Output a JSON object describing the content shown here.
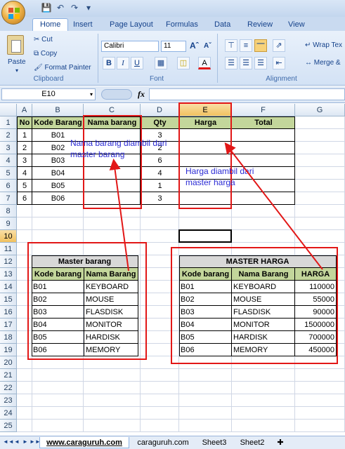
{
  "ribbon": {
    "tabs": [
      "Home",
      "Insert",
      "Page Layout",
      "Formulas",
      "Data",
      "Review",
      "View"
    ],
    "active_tab": "Home",
    "clipboard": {
      "paste": "Paste",
      "cut": "Cut",
      "copy": "Copy",
      "format_painter": "Format Painter",
      "label": "Clipboard"
    },
    "font": {
      "name": "Calibri",
      "size": "11",
      "label": "Font"
    },
    "alignment": {
      "wrap": "Wrap Tex",
      "merge": "Merge &",
      "label": "Alignment"
    }
  },
  "formula_bar": {
    "name_box": "E10",
    "fx": "fx",
    "value": ""
  },
  "grid": {
    "columns": [
      "A",
      "B",
      "C",
      "D",
      "E",
      "F",
      "G"
    ],
    "selected_column": "E",
    "rows": [
      "1",
      "2",
      "3",
      "4",
      "5",
      "6",
      "7",
      "8",
      "9",
      "10",
      "11",
      "12",
      "13",
      "14",
      "15",
      "16",
      "17",
      "18",
      "19",
      "20",
      "21",
      "22",
      "23",
      "24",
      "25"
    ],
    "selected_row": "10",
    "active_cell": "E10"
  },
  "main_table": {
    "headers": [
      "No",
      "Kode Barang",
      "Nama barang",
      "Qty",
      "Harga",
      "Total"
    ],
    "rows": [
      [
        "1",
        "B01",
        "",
        "3",
        "",
        ""
      ],
      [
        "2",
        "B02",
        "",
        "2",
        "",
        ""
      ],
      [
        "3",
        "B03",
        "",
        "6",
        "",
        ""
      ],
      [
        "4",
        "B04",
        "",
        "4",
        "",
        ""
      ],
      [
        "5",
        "B05",
        "",
        "1",
        "",
        ""
      ],
      [
        "6",
        "B06",
        "",
        "3",
        "",
        ""
      ]
    ]
  },
  "master_barang": {
    "title": "Master barang",
    "headers": [
      "Kode barang",
      "Nama Barang"
    ],
    "rows": [
      [
        "B01",
        "KEYBOARD"
      ],
      [
        "B02",
        "MOUSE"
      ],
      [
        "B03",
        "FLASDISK"
      ],
      [
        "B04",
        "MONITOR"
      ],
      [
        "B05",
        "HARDISK"
      ],
      [
        "B06",
        "MEMORY"
      ]
    ]
  },
  "master_harga": {
    "title": "MASTER HARGA",
    "headers": [
      "Kode barang",
      "Nama Barang",
      "HARGA"
    ],
    "rows": [
      [
        "B01",
        "KEYBOARD",
        "110000"
      ],
      [
        "B02",
        "MOUSE",
        "55000"
      ],
      [
        "B03",
        "FLASDISK",
        "90000"
      ],
      [
        "B04",
        "MONITOR",
        "1500000"
      ],
      [
        "B05",
        "HARDISK",
        "700000"
      ],
      [
        "B06",
        "MEMORY",
        "450000"
      ]
    ]
  },
  "annotations": {
    "nama_note": "Nama barang diambil dari master barang",
    "harga_note": "Harga diambil dari master harga",
    "line_color": "#e21717",
    "text_color": "#2b2bd4"
  },
  "sheets": [
    "www.caraguruh.com",
    "caraguruh.com",
    "Sheet3",
    "Sheet2"
  ],
  "active_sheet": "www.caraguruh.com"
}
